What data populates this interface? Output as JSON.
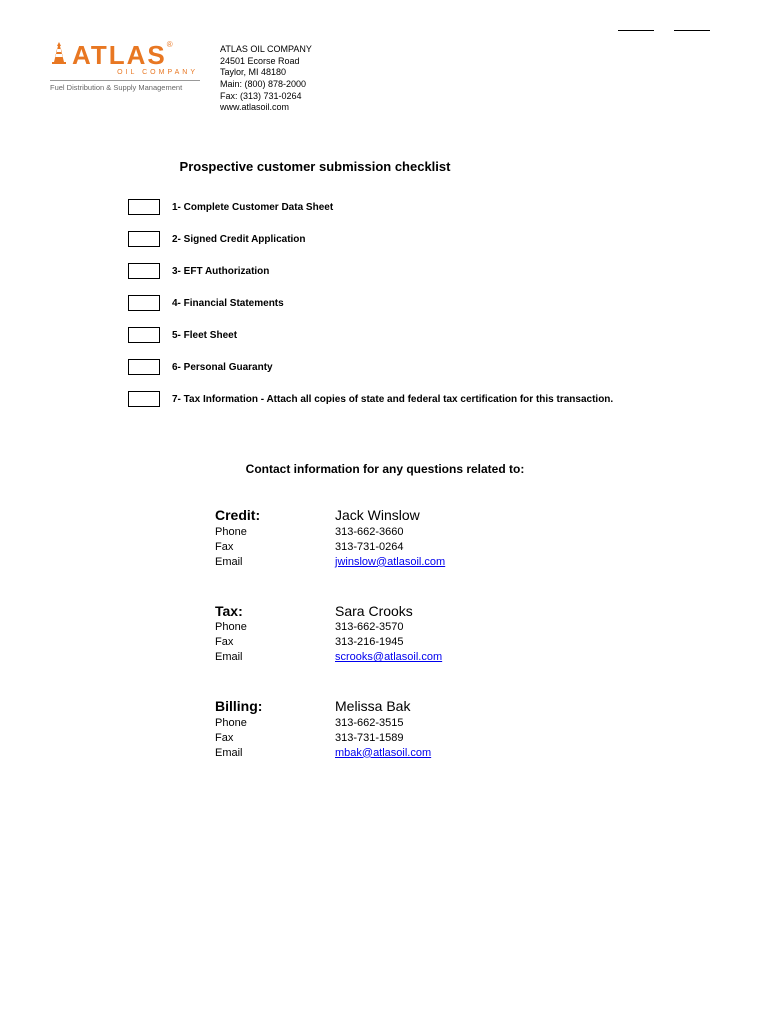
{
  "company": {
    "logo_text": "ATLAS",
    "logo_sub": "OIL COMPANY",
    "logo_tagline": "Fuel Distribution & Supply Management",
    "name": "ATLAS OIL COMPANY",
    "address1": "24501 Ecorse Road",
    "address2": "Taylor, MI 48180",
    "main": "Main: (800) 878-2000",
    "fax": "Fax: (313) 731-0264",
    "web": "www.atlasoil.com"
  },
  "title": "Prospective customer submission checklist",
  "items": [
    "1-  Complete Customer Data Sheet",
    "2-  Signed Credit Application",
    "3-  EFT Authorization",
    "4-  Financial Statements",
    "5-  Fleet Sheet",
    "6-  Personal Guaranty",
    "7-  Tax Information - Attach all copies of state and federal tax certification for this transaction."
  ],
  "contact_title": "Contact information for any questions related to:",
  "contacts": [
    {
      "dept": "Credit:",
      "name": "Jack Winslow",
      "phone_label": "Phone",
      "phone": "313-662-3660",
      "fax_label": "Fax",
      "fax": "313-731-0264",
      "email_label": "Email",
      "email": "jwinslow@atlasoil.com"
    },
    {
      "dept": "Tax:",
      "name": "Sara Crooks",
      "phone_label": "Phone",
      "phone": "313-662-3570",
      "fax_label": "Fax",
      "fax": "313-216-1945",
      "email_label": "Email",
      "email": "scrooks@atlasoil.com"
    },
    {
      "dept": "Billing:",
      "name": "Melissa Bak",
      "phone_label": "Phone",
      "phone": "313-662-3515",
      "fax_label": "Fax",
      "fax": "313-731-1589",
      "email_label": "Email",
      "email": "mbak@atlasoil.com"
    }
  ]
}
